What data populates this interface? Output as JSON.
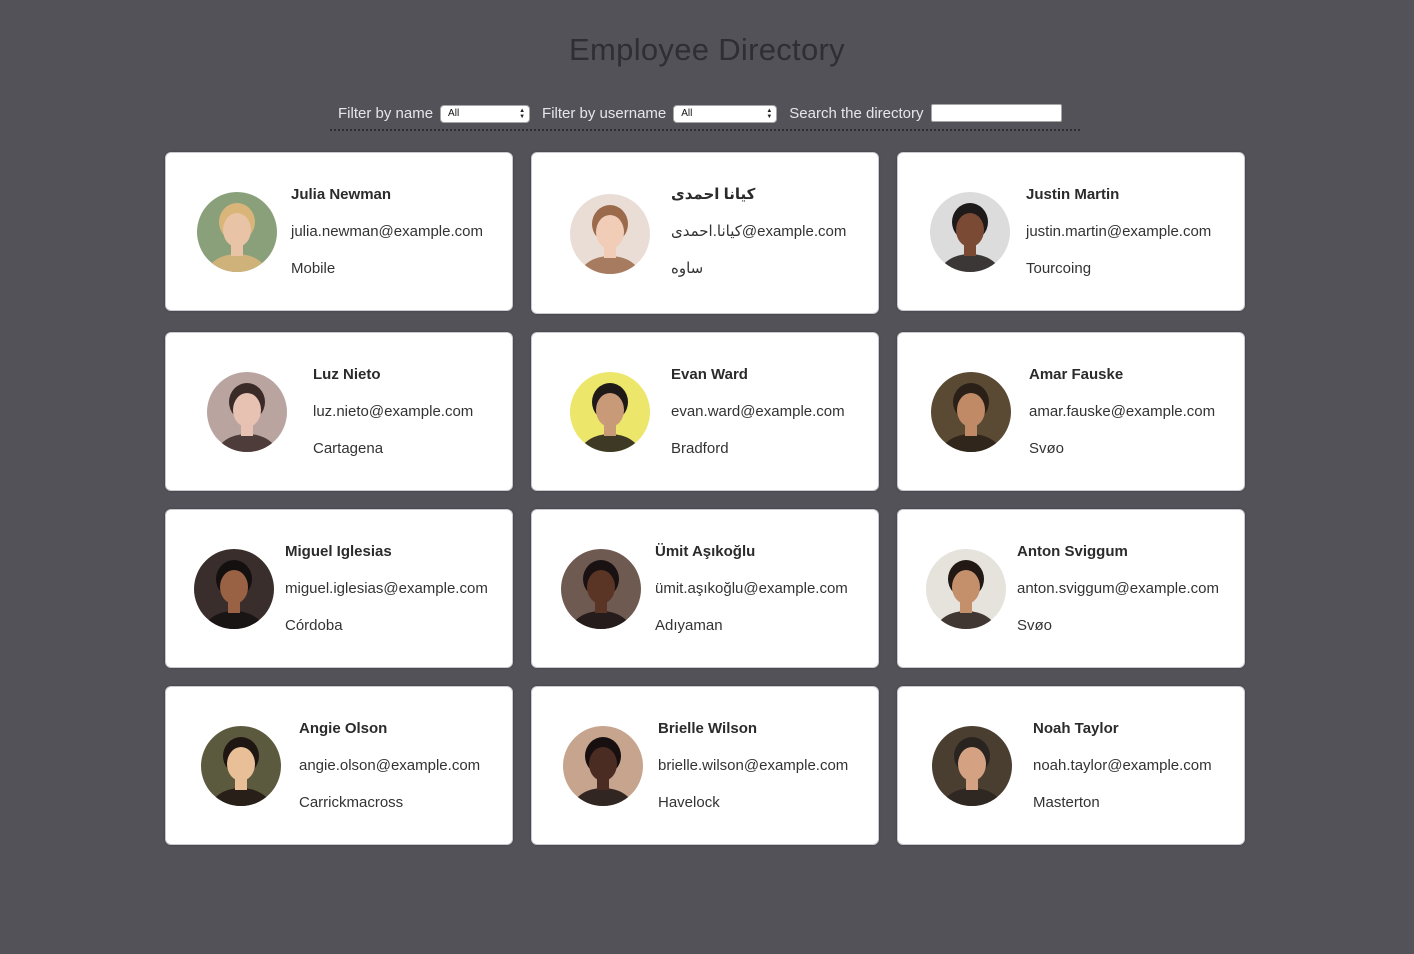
{
  "header": {
    "title": "Employee Directory"
  },
  "filters": {
    "name_label": "Filter by name",
    "name_selected": "All",
    "username_label": "Filter by username",
    "username_selected": "All",
    "search_label": "Search the directory",
    "search_value": ""
  },
  "employees": [
    {
      "name": "Julia Newman",
      "email": "julia.newman@example.com",
      "city": "Mobile",
      "avatar_bg": "#8aa07a",
      "skin": "#e9c3a5",
      "hair": "#d9b57a"
    },
    {
      "name": "كيانا احمدی",
      "email": "كيانا.احمدی@example.com",
      "city": "ساوه",
      "avatar_bg": "#e9ddd5",
      "skin": "#f1cdb8",
      "hair": "#9a6a4a"
    },
    {
      "name": "Justin Martin",
      "email": "justin.martin@example.com",
      "city": "Tourcoing",
      "avatar_bg": "#dcdcdc",
      "skin": "#7a4a34",
      "hair": "#1e1a1a"
    },
    {
      "name": "Luz Nieto",
      "email": "luz.nieto@example.com",
      "city": "Cartagena",
      "avatar_bg": "#b9a4a0",
      "skin": "#e7c1b1",
      "hair": "#3a2a28"
    },
    {
      "name": "Evan Ward",
      "email": "evan.ward@example.com",
      "city": "Bradford",
      "avatar_bg": "#ece66a",
      "skin": "#c99a78",
      "hair": "#1f1a18"
    },
    {
      "name": "Amar Fauske",
      "email": "amar.fauske@example.com",
      "city": "Svøo",
      "avatar_bg": "#5a4a34",
      "skin": "#c08a66",
      "hair": "#2a2018"
    },
    {
      "name": "Miguel Iglesias",
      "email": "miguel.iglesias@example.com",
      "city": "Córdoba",
      "avatar_bg": "#3a2e2c",
      "skin": "#9a6244",
      "hair": "#141010"
    },
    {
      "name": "Ümit Aşıkoğlu",
      "email": "ümit.aşıkoğlu@example.com",
      "city": "Adıyaman",
      "avatar_bg": "#6e5a50",
      "skin": "#5a3424",
      "hair": "#1a1212"
    },
    {
      "name": "Anton Sviggum",
      "email": "anton.sviggum@example.com",
      "city": "Svøo",
      "avatar_bg": "#e6e2dc",
      "skin": "#c4906c",
      "hair": "#221814"
    },
    {
      "name": "Angie Olson",
      "email": "angie.olson@example.com",
      "city": "Carrickmacross",
      "avatar_bg": "#5c5a3e",
      "skin": "#e9bf98",
      "hair": "#1e1612"
    },
    {
      "name": "Brielle Wilson",
      "email": "brielle.wilson@example.com",
      "city": "Havelock",
      "avatar_bg": "#c6a48e",
      "skin": "#4a2c22",
      "hair": "#181010"
    },
    {
      "name": "Noah Taylor",
      "email": "noah.taylor@example.com",
      "city": "Masterton",
      "avatar_bg": "#4a3e30",
      "skin": "#d4a282",
      "hair": "#2a2420"
    }
  ]
}
